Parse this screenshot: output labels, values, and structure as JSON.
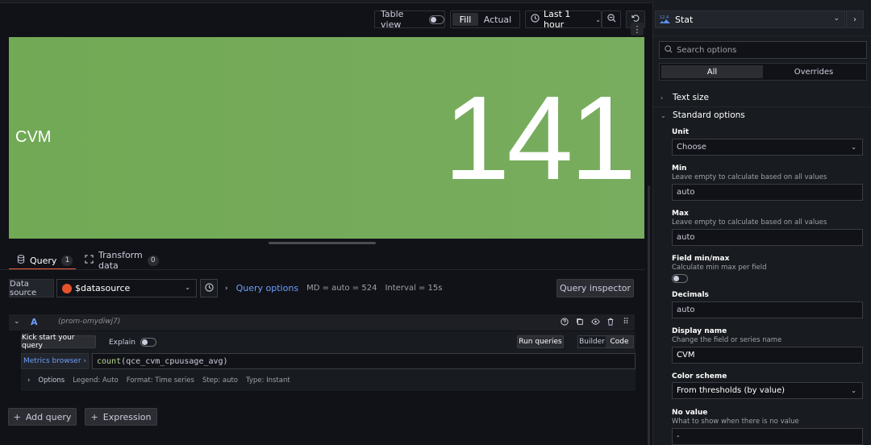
{
  "toolbar": {
    "table_view_label": "Table view",
    "fill_label": "Fill",
    "actual_label": "Actual",
    "time_range": "Last 1 hour"
  },
  "panel": {
    "label": "CVM",
    "value": "141",
    "background_color": "#73a95a"
  },
  "tabs": [
    {
      "label": "Query",
      "count": "1"
    },
    {
      "label": "Transform data",
      "count": "0"
    }
  ],
  "datasource": {
    "label": "Data source",
    "value": "$datasource",
    "query_options_link": "Query options",
    "md": "MD = auto = 524",
    "interval": "Interval = 15s",
    "inspector_label": "Query inspector"
  },
  "query": {
    "letter": "A",
    "ref": "(prom-omydiwj7)",
    "kick_start": "Kick start your query",
    "explain": "Explain",
    "run_queries": "Run queries",
    "builder": "Builder",
    "code": "Code",
    "metrics_browser": "Metrics browser ›",
    "expression_fn": "count",
    "expression_arg": "(qce_cvm_cpuusage_avg)",
    "options": {
      "title": "Options",
      "legend": "Legend: Auto",
      "format": "Format: Time series",
      "step": "Step: auto",
      "type": "Type: Instant"
    }
  },
  "actions": {
    "add_query": "Add query",
    "expression": "Expression"
  },
  "sidebar": {
    "viz_name": "Stat",
    "search_placeholder": "Search options",
    "tab_all": "All",
    "tab_overrides": "Overrides",
    "groups": {
      "text_size": "Text size",
      "standard_options": "Standard options"
    },
    "fields": {
      "unit_label": "Unit",
      "unit_value": "Choose",
      "min_label": "Min",
      "min_desc": "Leave empty to calculate based on all values",
      "min_value": "auto",
      "max_label": "Max",
      "max_desc": "Leave empty to calculate based on all values",
      "max_value": "auto",
      "fieldminmax_label": "Field min/max",
      "fieldminmax_desc": "Calculate min max per field",
      "decimals_label": "Decimals",
      "decimals_value": "auto",
      "display_name_label": "Display name",
      "display_name_desc": "Change the field or series name",
      "display_name_value": "CVM",
      "color_scheme_label": "Color scheme",
      "color_scheme_value": "From thresholds (by value)",
      "no_value_label": "No value",
      "no_value_desc": "What to show when there is no value",
      "no_value_value": "-"
    }
  },
  "colors": {
    "accent": "#6e9fff",
    "tab_underline": "#f55f3e",
    "background": "#111217"
  }
}
